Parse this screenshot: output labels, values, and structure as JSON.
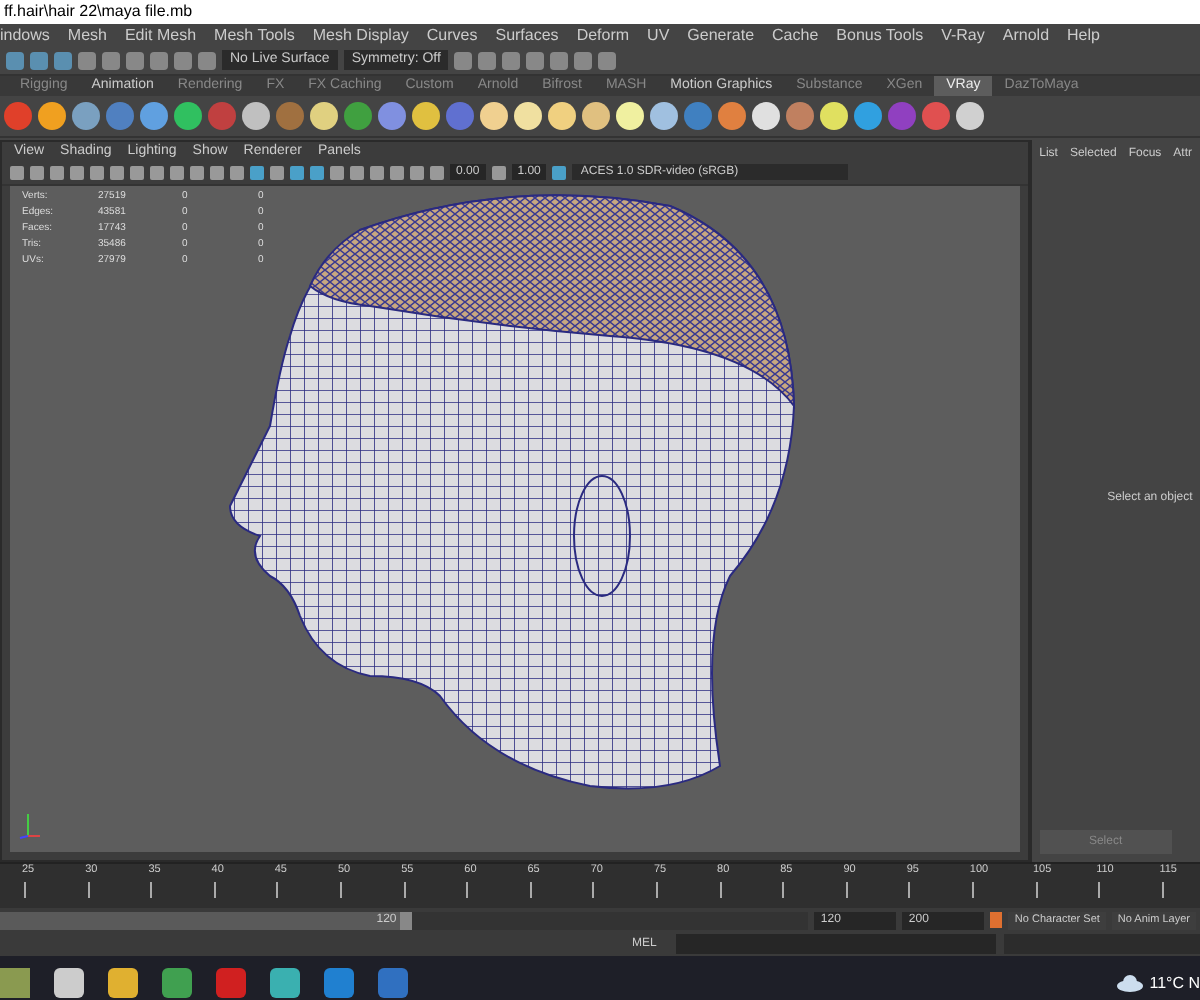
{
  "window": {
    "title": "ff.hair\\hair 22\\maya file.mb"
  },
  "menu_bar": [
    "indows",
    "Mesh",
    "Edit Mesh",
    "Mesh Tools",
    "Mesh Display",
    "Curves",
    "Surfaces",
    "Deform",
    "UV",
    "Generate",
    "Cache",
    "Bonus Tools",
    "V-Ray",
    "Arnold",
    "Help"
  ],
  "status_line": {
    "live_surface": "No Live Surface",
    "symmetry": "Symmetry: Off"
  },
  "shelf_tabs": [
    {
      "label": "Rigging",
      "selected": false
    },
    {
      "label": "Animation",
      "selected": false
    },
    {
      "label": "Rendering",
      "selected": false
    },
    {
      "label": "FX",
      "selected": false
    },
    {
      "label": "FX Caching",
      "selected": false
    },
    {
      "label": "Custom",
      "selected": false
    },
    {
      "label": "Arnold",
      "selected": false
    },
    {
      "label": "Bifrost",
      "selected": false
    },
    {
      "label": "MASH",
      "selected": false
    },
    {
      "label": "Motion Graphics",
      "selected": false
    },
    {
      "label": "Substance",
      "selected": false
    },
    {
      "label": "XGen",
      "selected": false
    },
    {
      "label": "VRay",
      "selected": true
    },
    {
      "label": "DazToMaya",
      "selected": false
    }
  ],
  "viewport": {
    "menu": [
      "View",
      "Shading",
      "Lighting",
      "Show",
      "Renderer",
      "Panels"
    ],
    "exposure": "0.00",
    "gamma": "1.00",
    "color_space": "ACES 1.0 SDR-video (sRGB)",
    "hud": [
      {
        "label": "Verts:",
        "values": [
          "27519",
          "0",
          "0"
        ]
      },
      {
        "label": "Edges:",
        "values": [
          "43581",
          "0",
          "0"
        ]
      },
      {
        "label": "Faces:",
        "values": [
          "17743",
          "0",
          "0"
        ]
      },
      {
        "label": "Tris:",
        "values": [
          "35486",
          "0",
          "0"
        ]
      },
      {
        "label": "UVs:",
        "values": [
          "27979",
          "0",
          "0"
        ]
      }
    ]
  },
  "attribute_editor": {
    "tabs": [
      "List",
      "Selected",
      "Focus",
      "Attr"
    ],
    "message": "Select an object",
    "button": "Select"
  },
  "time_slider": {
    "ticks": [
      "25",
      "30",
      "35",
      "40",
      "45",
      "50",
      "55",
      "60",
      "65",
      "70",
      "75",
      "80",
      "85",
      "90",
      "95",
      "100",
      "105",
      "110",
      "115"
    ]
  },
  "range_slider": {
    "level": 0.51,
    "current": "120",
    "end": "120",
    "max": "200",
    "character_set": "No Character Set",
    "anim_layer": "No Anim Layer"
  },
  "command_line": {
    "language": "MEL"
  },
  "taskbar": {
    "weather": "11°C N"
  }
}
